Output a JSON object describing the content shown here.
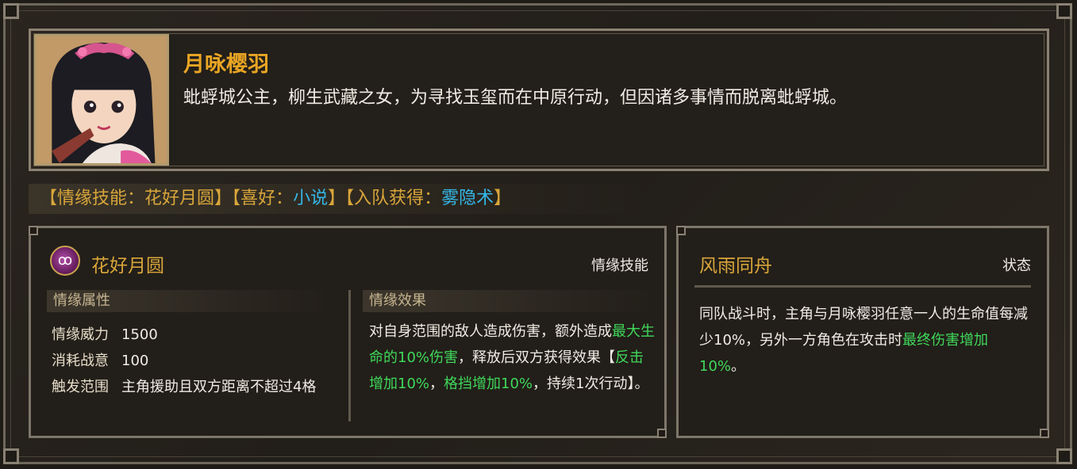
{
  "character": {
    "name": "月咏樱羽",
    "description": "蚍蜉城公主，柳生武藏之女，为寻找玉玺而在中原行动，但因诸多事情而脱离蚍蜉城。"
  },
  "tags": {
    "bond_skill_prefix": "【情缘技能：",
    "bond_skill": "花好月圆",
    "bond_skill_suffix": "】",
    "hobby_prefix": "【喜好：",
    "hobby": "小说",
    "hobby_suffix": "】",
    "join_prefix": "【入队获得：",
    "join_reward": "雾隐术",
    "join_suffix": "】"
  },
  "skill": {
    "icon_glyph": "ꝏ",
    "name": "花好月圆",
    "type": "情缘技能",
    "attr_header": "情缘属性",
    "effect_header": "情缘效果",
    "attributes": [
      {
        "key": "情缘威力",
        "value": "1500"
      },
      {
        "key": "消耗战意",
        "value": "100"
      },
      {
        "key": "触发范围",
        "value": "主角援助且双方距离不超过4格"
      }
    ],
    "effect": {
      "part1": "对自身范围的敌人造成伤害，额外造成",
      "highlight1": "最大生命的10%伤害",
      "part2": "，释放后双方获得效果【",
      "highlight2": "反击增加10%",
      "part3": "，",
      "highlight3": "格挡增加10%",
      "part4": "，持续1次行动】。"
    }
  },
  "status": {
    "name": "风雨同舟",
    "type": "状态",
    "text_part1": "同队战斗时，主角与月咏樱羽任意一人的生命值每减少10%，另外一方角色在攻击时",
    "highlight": "最终伤害增加10%",
    "text_part2": "。"
  },
  "colors": {
    "gold": "#d9a63a",
    "blue": "#34b7e8",
    "green": "#3fd85a"
  }
}
